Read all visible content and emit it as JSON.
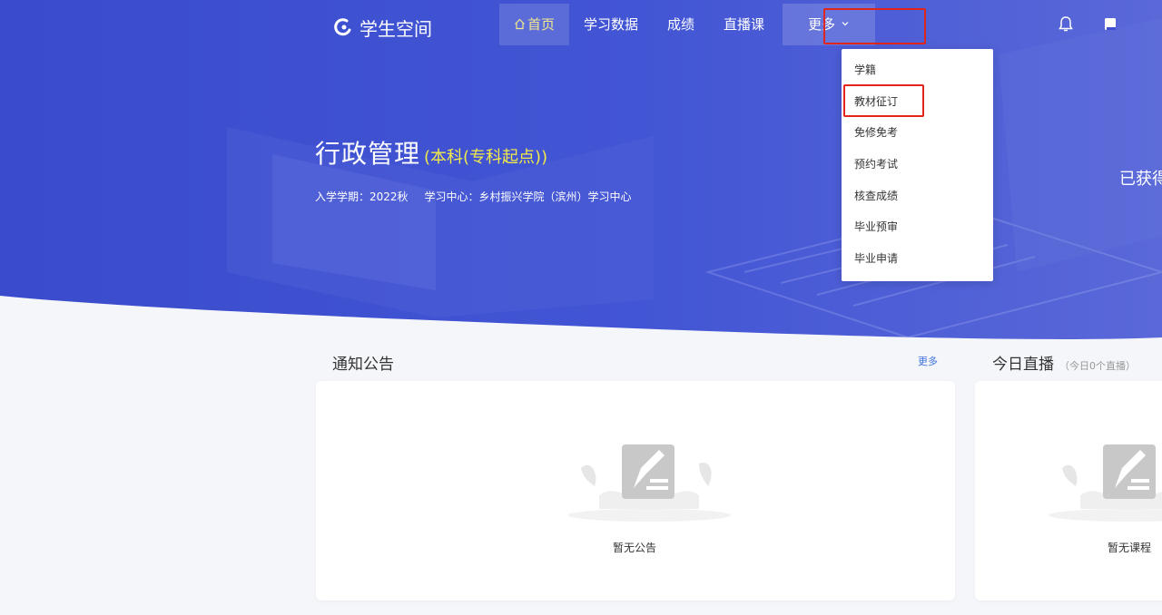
{
  "brand": {
    "name": "学生空间"
  },
  "nav": {
    "items": [
      {
        "label": "首页",
        "active": true
      },
      {
        "label": "学习数据"
      },
      {
        "label": "成绩"
      },
      {
        "label": "直播课"
      },
      {
        "label": "更多"
      }
    ]
  },
  "more_menu": {
    "items": [
      {
        "label": "学籍"
      },
      {
        "label": "教材征订"
      },
      {
        "label": "免修免考"
      },
      {
        "label": "预约考试"
      },
      {
        "label": "核查成绩"
      },
      {
        "label": "毕业预审"
      },
      {
        "label": "毕业申请"
      }
    ]
  },
  "student": {
    "major": "行政管理",
    "level": "(本科(专科起点))",
    "enroll_term": "入学学期：2022秋",
    "center": "学习中心：乡村振兴学院（滨州）学习中心",
    "earned_partial": "已获得"
  },
  "notices": {
    "title": "通知公告",
    "more": "更多",
    "empty": "暂无公告"
  },
  "live": {
    "title": "今日直播",
    "count_note": "（今日0个直播）",
    "empty": "暂无课程"
  },
  "colors": {
    "hero_blue": "#3f4fd0",
    "active_nav_text": "#f2e98e",
    "level_text": "#f2e94a",
    "highlight_red": "#e1251b",
    "link_blue": "#3f72e0"
  },
  "icons": [
    "logo-icon",
    "home-icon",
    "chevron-down-icon",
    "bell-icon",
    "book-icon",
    "empty-notes-icon"
  ]
}
